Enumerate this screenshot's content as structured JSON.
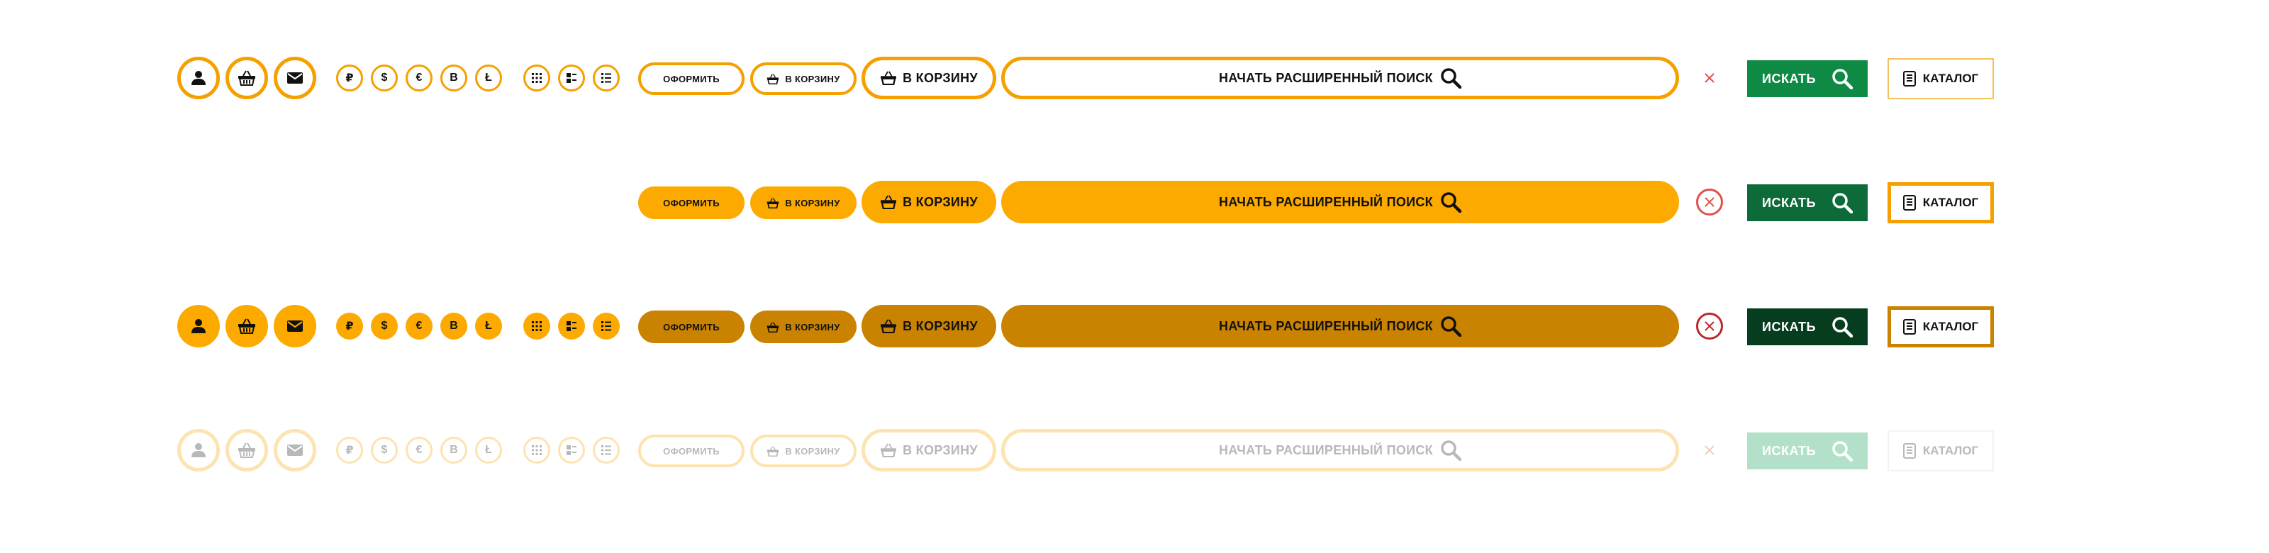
{
  "labels": {
    "checkout": "ОФОРМИТЬ",
    "to_cart": "В КОРЗИНУ",
    "search_placeholder": "НАЧАТЬ РАСШИРЕННЫЙ ПОИСК",
    "find": "ИСКАТЬ",
    "catalog": "КАТАЛОГ"
  },
  "icons": {
    "round": [
      "user-icon",
      "basket-icon",
      "mail-icon"
    ],
    "currencies": [
      "ruble-icon",
      "dollar-icon",
      "euro-icon",
      "bitcoin-icon",
      "litecoin-icon"
    ],
    "views": [
      "grid-view-icon",
      "tiles-view-icon",
      "list-view-icon"
    ],
    "currency_glyphs": [
      "₽",
      "$",
      "€",
      "B",
      "Ł"
    ]
  },
  "states": [
    "default",
    "hover",
    "active",
    "disabled"
  ],
  "colors": {
    "accent": "#fdaa00",
    "accent_dark": "#c98300",
    "green": "#0f8a45",
    "green_hover": "#0c6b38",
    "green_active": "#063d1f",
    "green_disabled": "#b3e0c8",
    "close_red": "#e0504a"
  }
}
